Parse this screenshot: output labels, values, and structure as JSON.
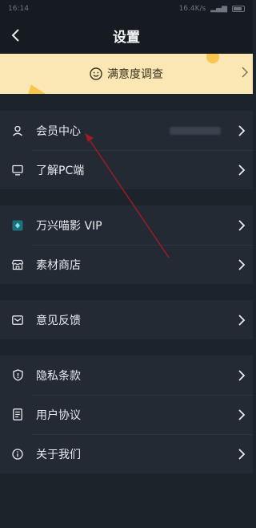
{
  "status_bar": {
    "time": "16:14",
    "info": "16.4K/s"
  },
  "navbar": {
    "title": "设置"
  },
  "survey": {
    "label": "满意度调查"
  },
  "groups": [
    {
      "items": [
        {
          "label": "会员中心",
          "icon": "person-icon"
        },
        {
          "label": "了解PC端",
          "icon": "monitor-icon"
        }
      ]
    },
    {
      "items": [
        {
          "label": "万兴喵影 VIP",
          "icon": "vip-diamond-icon"
        },
        {
          "label": "素材商店",
          "icon": "store-icon"
        }
      ]
    },
    {
      "items": [
        {
          "label": "意见反馈",
          "icon": "mail-icon"
        }
      ]
    },
    {
      "items": [
        {
          "label": "隐私条款",
          "icon": "shield-icon"
        },
        {
          "label": "用户协议",
          "icon": "document-icon"
        },
        {
          "label": "关于我们",
          "icon": "info-icon"
        }
      ]
    }
  ],
  "colors": {
    "background": "#1d232b",
    "row": "#232a33",
    "survey_banner": "#fbe7b3",
    "annotation_arrow": "#a31b22"
  }
}
